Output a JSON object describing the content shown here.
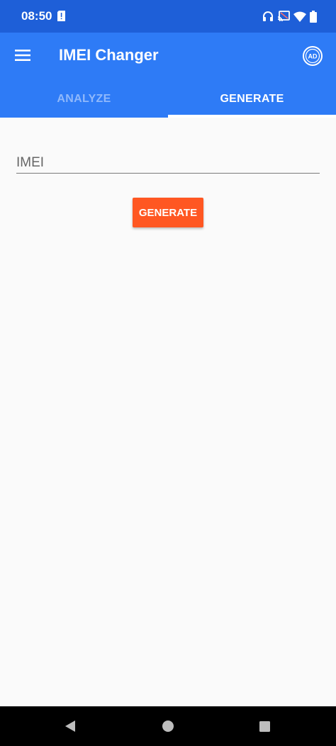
{
  "status_bar": {
    "time": "08:50",
    "icons": [
      "sim-alert-icon",
      "headphones-icon",
      "cast-icon",
      "wifi-icon",
      "battery-icon"
    ]
  },
  "app_bar": {
    "title": "IMEI Changer",
    "menu_icon": "menu-icon",
    "ad_icon": "ad-icon",
    "background_color": "#2e7bf6"
  },
  "tabs": [
    {
      "label": "ANALYZE",
      "active": false
    },
    {
      "label": "GENERATE",
      "active": true
    }
  ],
  "form": {
    "imei_placeholder": "IMEI",
    "imei_value": "",
    "generate_label": "GENERATE",
    "button_color": "#ff5722"
  },
  "nav_bar": {
    "icons": [
      "back-icon",
      "home-icon",
      "recents-icon"
    ]
  }
}
